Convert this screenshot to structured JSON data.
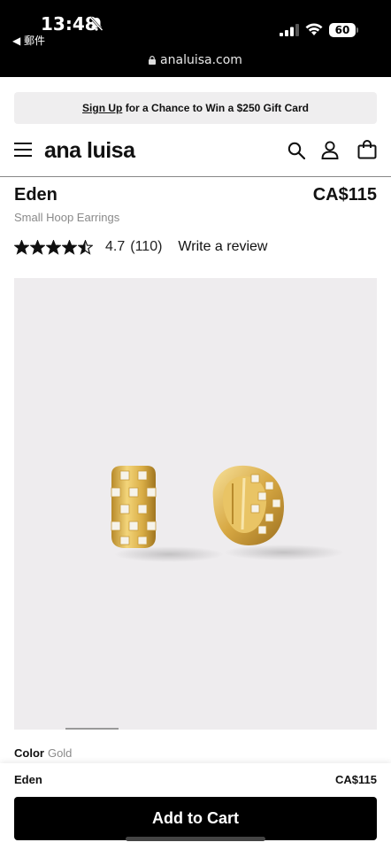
{
  "status_bar": {
    "time": "13:48",
    "back_label": "◀ 郵件",
    "battery": "60",
    "url": "analuisa.com"
  },
  "promo": {
    "link": "Sign Up",
    "text": " for a Chance to Win a $250 Gift Card"
  },
  "header": {
    "logo": "ana luisa"
  },
  "product": {
    "name": "Eden",
    "price": "CA$115",
    "subtitle": "Small Hoop Earrings",
    "rating": "4.7",
    "reviews": "(110)",
    "write_review": "Write a review",
    "stars_filled": 4.5,
    "color_label": "Color",
    "color_value": "Gold"
  },
  "sticky": {
    "name": "Eden",
    "price": "CA$115",
    "add_to_cart": "Add to Cart"
  },
  "icons": {
    "menu": "menu-icon",
    "search": "search-icon",
    "account": "account-icon",
    "bag": "bag-icon",
    "lock": "lock-icon",
    "star": "star-icon"
  },
  "colors": {
    "status_bar_bg": "#000000",
    "promo_bg": "#efeeef",
    "gallery_bg": "#eeecee",
    "gold": "#d8b04a",
    "button_bg": "#000000"
  }
}
